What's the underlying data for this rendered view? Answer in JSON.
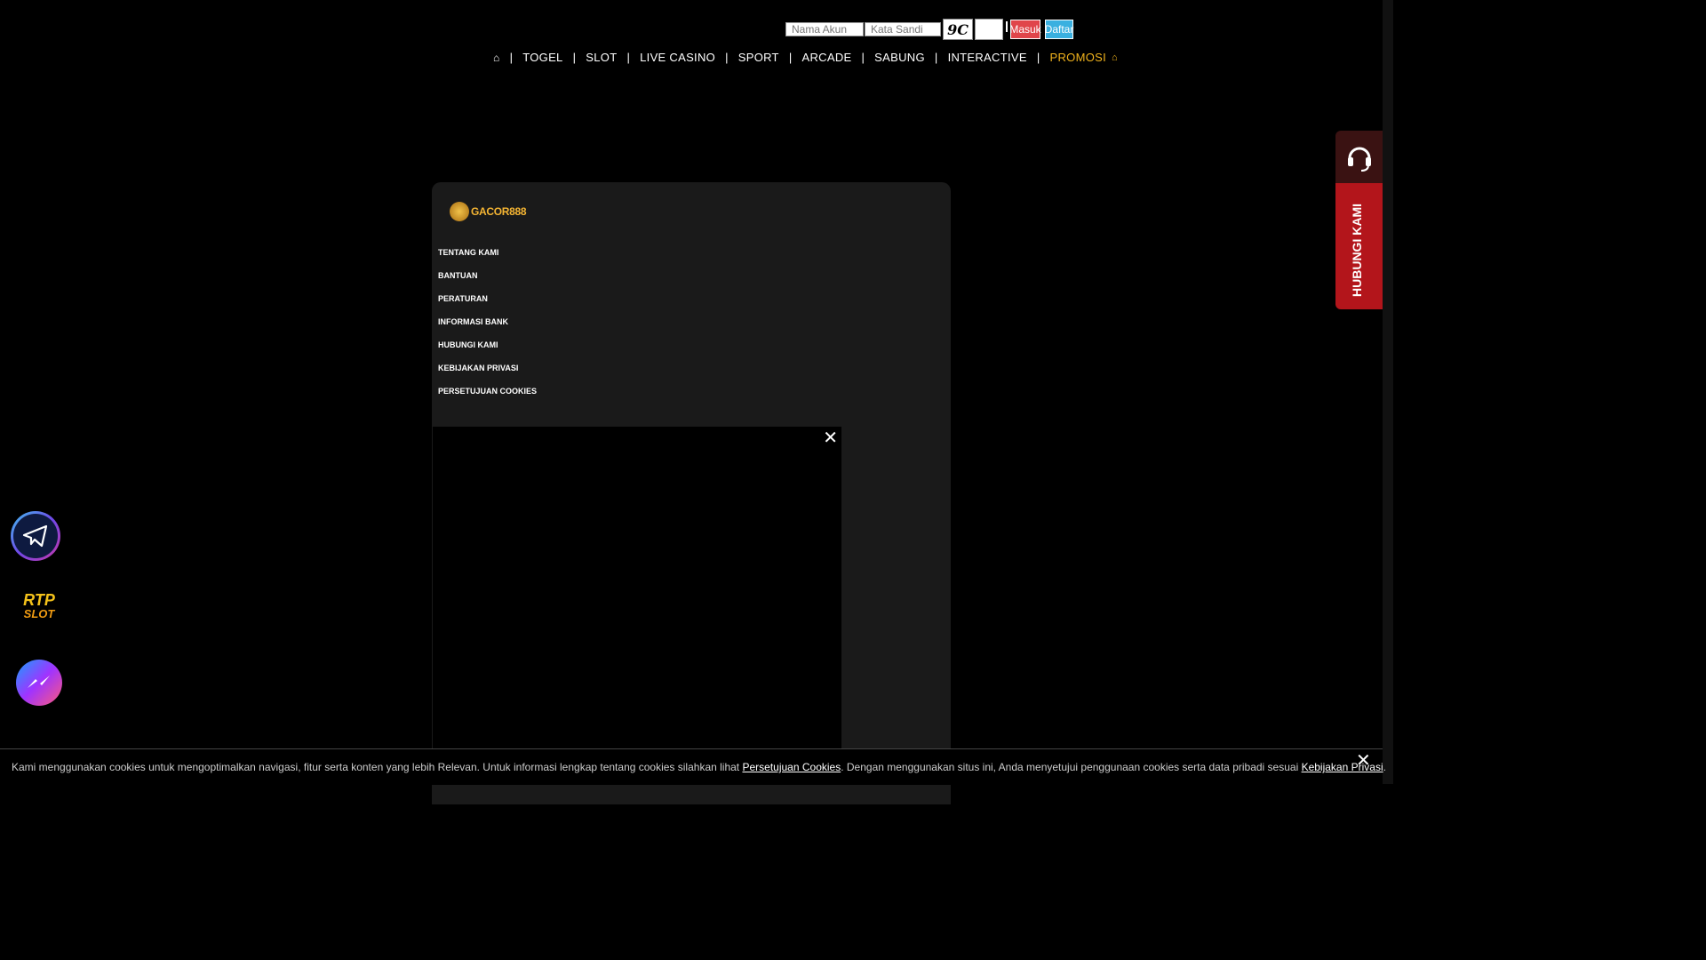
{
  "login": {
    "username_placeholder": "Nama Akun",
    "password_placeholder": "Kata Sandi",
    "captcha": "9C",
    "login_label": "Masuk",
    "register_label": "Daftar"
  },
  "nav": {
    "home_icon": "home-icon",
    "items": [
      "TOGEL",
      "SLOT",
      "LIVE CASINO",
      "SPORT",
      "ARCADE",
      "SABUNG",
      "INTERACTIVE",
      "PROMOSI"
    ],
    "promo_icon": "gift-icon"
  },
  "footer": {
    "logo_text": "GACOR888",
    "links": [
      "TENTANG KAMI",
      "BANTUAN",
      "PERATURAN",
      "INFORMASI BANK",
      "HUBUNGI KAMI",
      "KEBIJAKAN PRIVASI",
      "PERSETUJUAN COOKIES"
    ]
  },
  "popup": {
    "close": "✕"
  },
  "contact_tab": {
    "label": "HUBUNGI KAMI",
    "icon": "headset-icon"
  },
  "floating": {
    "telegram_icon": "telegram-icon",
    "rtp_top": "RTP",
    "rtp_bottom": "SLOT",
    "messenger_icon": "messenger-icon"
  },
  "cookie": {
    "text_before": "Kami menggunakan cookies untuk mengoptimalkan navigasi, fitur serta konten yang lebih Relevan. Untuk informasi lengkap tentang cookies silahkan lihat ",
    "link1": "Persetujuan Cookies",
    "text_middle": ". Dengan menggunakan situs ini, Anda menyetujui penggunaan cookies serta data pribadi sesuai ",
    "link2": "Kebijakan Privasi",
    "text_after": ".",
    "close": "✕"
  },
  "colors": {
    "brand_gold": "#f1b31c",
    "login_red": "#e0454a",
    "register_blue": "#3ab0e0",
    "contact_red": "#b3151b"
  }
}
